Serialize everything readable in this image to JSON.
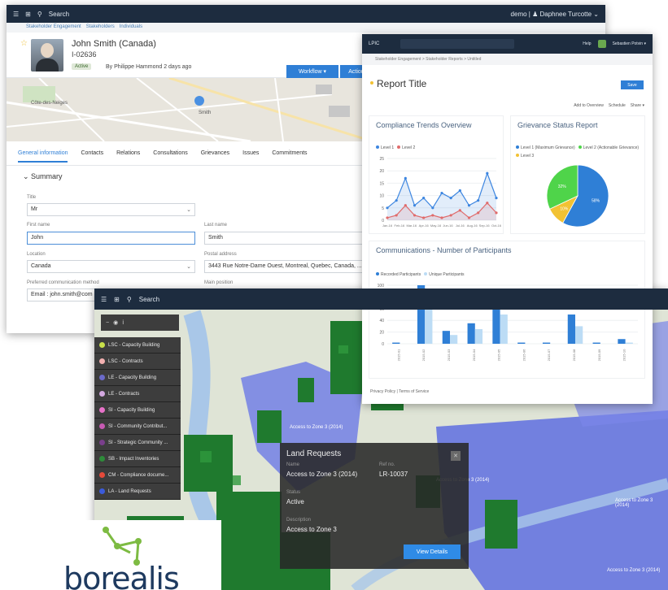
{
  "w1": {
    "topbar": {
      "search": "Search",
      "user": "demo | ♟ Daphnee Turcotte ⌄"
    },
    "breadcrumb": [
      "Stakeholder Engagement",
      "Stakeholders",
      "Individuals"
    ],
    "person": {
      "name": "John Smith (Canada)",
      "id": "I-02636",
      "status": "Active",
      "byline": "By Philippe Hammond 2 days ago",
      "workflow_label": "Workflow ▾",
      "action_label": "Action"
    },
    "map_labels": [
      "Côte-des-Neiges",
      "Smith",
      "Montréal"
    ],
    "tabs": [
      "General information",
      "Contacts",
      "Relations",
      "Consultations",
      "Grievances",
      "Issues",
      "Commitments"
    ],
    "summary_heading": "Summary",
    "form": {
      "title_label": "Title",
      "title_value": "Mr",
      "first_name_label": "First name",
      "first_name_value": "John",
      "last_name_label": "Last name",
      "last_name_value": "Smith",
      "location_label": "Location",
      "location_value": "Canada",
      "postal_label": "Postal address",
      "postal_value": "3443 Rue Notre-Dame Ouest, Montreal, Quebec, Canada, ...",
      "pref_label": "Preferred communication method",
      "pref_value": "Email : john.smith@com",
      "main_position_label": "Main position"
    }
  },
  "w2": {
    "topbar": {
      "app": "LPIC",
      "user": "Sebastien Potvin ▾",
      "help": "Help"
    },
    "breadcrumb": "Stakeholder Engagement  >  Stakeholder Reports  >  Untitled",
    "report_title": "Report Title",
    "save_label": "Save",
    "tools": [
      "Add to Overview",
      "Schedule",
      "Share ▾"
    ],
    "footer": "Privacy Policy  |  Terms of Service"
  },
  "w3": {
    "topbar": {
      "search": "Search"
    },
    "layers": [
      {
        "label": "LSC - Capacity Building",
        "color": "#c8e04a"
      },
      {
        "label": "LSC - Contracts",
        "color": "#f2b0b0"
      },
      {
        "label": "LE - Capacity Building",
        "color": "#6b6ac9"
      },
      {
        "label": "LE - Contracts",
        "color": "#d3a8e0"
      },
      {
        "label": "SI - Capacity Building",
        "color": "#e872c9"
      },
      {
        "label": "SI - Community Contribut...",
        "color": "#c75ab3"
      },
      {
        "label": "SI - Strategic Community ...",
        "color": "#7a3f8c"
      },
      {
        "label": "SB - Impact Inventories",
        "color": "#2e8b3a"
      },
      {
        "label": "CM - Compliance docume...",
        "color": "#e64a3a"
      },
      {
        "label": "LA - Land Requests",
        "color": "#3b5bdb"
      }
    ],
    "popup": {
      "title": "Land Requests",
      "name_label": "Name",
      "name_value": "Access to Zone 3 (2014)",
      "ref_label": "Ref no.",
      "ref_value": "LR-10037",
      "status_label": "Status",
      "status_value": "Active",
      "desc_label": "Description",
      "desc_value": "Access to Zone 3",
      "button": "View Details"
    },
    "map_labels": [
      "Access to Zone 3 (2014)",
      "Access to Zone 3 (2014)",
      "Access to Zone 3 (2014)",
      "Access to Zone 3 (2014)"
    ]
  },
  "logo_text": "borealis",
  "chart_data": [
    {
      "type": "line",
      "title": "Compliance Trends Overview",
      "categories": [
        "Jan-16",
        "Feb-16",
        "Mar-16",
        "Apr-16",
        "May-16",
        "Jun-16",
        "Jul-16",
        "Aug-16",
        "Sep-16",
        "Oct-16"
      ],
      "series": [
        {
          "name": "Level 1",
          "values": [
            5,
            8,
            17,
            6,
            9,
            5,
            11,
            9,
            12,
            6,
            8,
            19,
            9
          ],
          "color": "#3d86e0"
        },
        {
          "name": "Level 2",
          "values": [
            1,
            2,
            6,
            2,
            1,
            2,
            1,
            2,
            4,
            1,
            3,
            7,
            3
          ],
          "color": "#e06b6b"
        }
      ],
      "ylim": [
        0,
        25
      ],
      "yticks": [
        0,
        5,
        10,
        15,
        20,
        25
      ]
    },
    {
      "type": "pie",
      "title": "Grievance Status Report",
      "series": [
        {
          "name": "Level 1 (Maximum Grievance)",
          "value": 58,
          "color": "#2f7fd6"
        },
        {
          "name": "Level 2 (Actionable Grievance)",
          "value": 10,
          "color": "#f2c233"
        },
        {
          "name": "Level 3",
          "value": 32,
          "color": "#4fd44a"
        }
      ]
    },
    {
      "type": "bar",
      "title": "Communications - Number of Participants",
      "categories": [
        "2015-01",
        "2015-02",
        "2015-03",
        "2015-04",
        "2015-05",
        "2015-06",
        "2015-07",
        "2015-08",
        "2015-09",
        "2015-10"
      ],
      "series": [
        {
          "name": "Recorded Participants",
          "values": [
            2,
            100,
            22,
            35,
            65,
            2,
            2,
            50,
            2,
            8
          ],
          "color": "#2f7fd6"
        },
        {
          "name": "Unique Participants",
          "values": [
            0,
            60,
            15,
            25,
            50,
            0,
            0,
            30,
            0,
            2
          ],
          "color": "#bcdcf5"
        }
      ],
      "ylim": [
        0,
        100
      ],
      "yticks": [
        0,
        20,
        40,
        60,
        80,
        100
      ]
    }
  ]
}
